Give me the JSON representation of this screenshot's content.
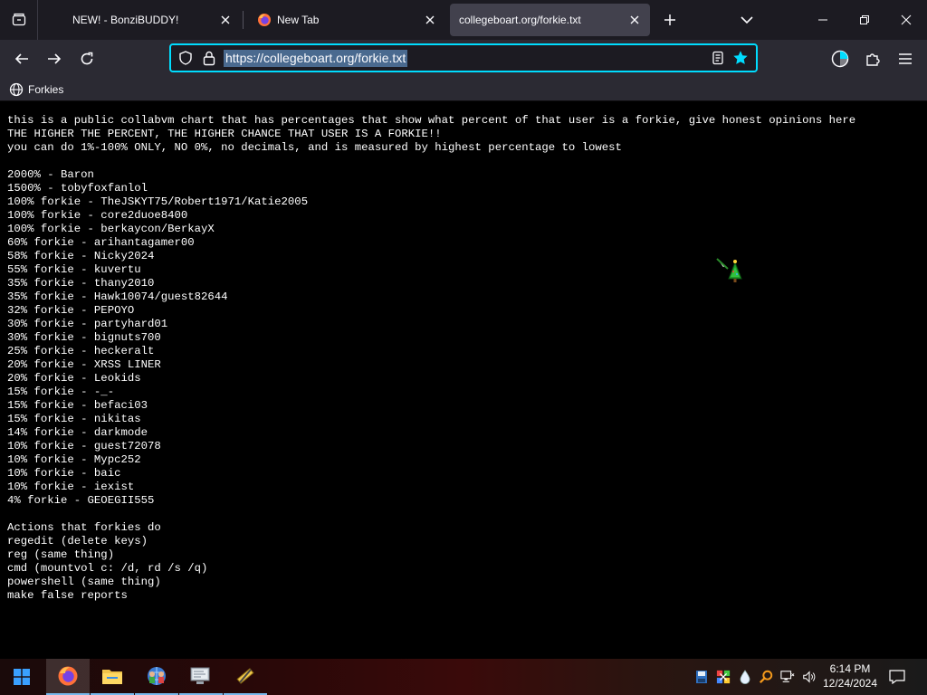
{
  "browser": {
    "tabs": [
      {
        "label": "NEW! - BonziBUDDY!",
        "active": false,
        "icon": "blank-page-icon"
      },
      {
        "label": "New Tab",
        "active": false,
        "icon": "firefox-icon"
      },
      {
        "label": "collegeboart.org/forkie.txt",
        "active": true,
        "icon": "none"
      }
    ],
    "url": "https://collegeboart.org/forkie.txt",
    "bookmarks": [
      {
        "label": "Forkies",
        "icon": "globe-icon"
      }
    ],
    "accent_color": "#00ddff",
    "star_color": "#00ddff"
  },
  "document": {
    "lines": [
      "this is a public collabvm chart that has percentages that show what percent of that user is a forkie, give honest opinions here",
      "THE HIGHER THE PERCENT, THE HIGHER CHANCE THAT USER IS A FORKIE!!",
      "you can do 1%-100% ONLY, NO 0%, no decimals, and is measured by highest percentage to lowest",
      "",
      "2000% - Baron",
      "1500% - tobyfoxfanlol",
      "100% forkie - TheJSKYT75/Robert1971/Katie2005",
      "100% forkie - core2duoe8400",
      "100% forkie - berkaycon/BerkayX",
      "60% forkie - arihantagamer00",
      "58% forkie - Nicky2024",
      "55% forkie - kuvertu",
      "35% forkie - thany2010",
      "35% forkie - Hawk10074/guest82644",
      "32% forkie - PEPOYO",
      "30% forkie - partyhard01",
      "30% forkie - bignuts700",
      "25% forkie - heckeralt",
      "20% forkie - XRSS LINER",
      "20% forkie - Leokids",
      "15% forkie - -_-",
      "15% forkie - befaci03",
      "15% forkie - nikitas",
      "14% forkie - darkmode",
      "10% forkie - guest72078",
      "10% forkie - Mypc252",
      "10% forkie - baic",
      "10% forkie - iexist",
      "4% forkie - GEOEGII555",
      "",
      "Actions that forkies do",
      "regedit (delete keys)",
      "reg (same thing)",
      "cmd (mountvol c: /d, rd /s /q)",
      "powershell (same thing)",
      "make false reports"
    ]
  },
  "taskbar": {
    "apps": [
      {
        "name": "firefox-icon",
        "state": "active"
      },
      {
        "name": "file-explorer-icon",
        "state": "open"
      },
      {
        "name": "network-people-icon",
        "state": "open"
      },
      {
        "name": "monitor-icon",
        "state": "open"
      },
      {
        "name": "tools-icon",
        "state": "open"
      }
    ],
    "time": "6:14 PM",
    "date": "12/24/2024"
  }
}
